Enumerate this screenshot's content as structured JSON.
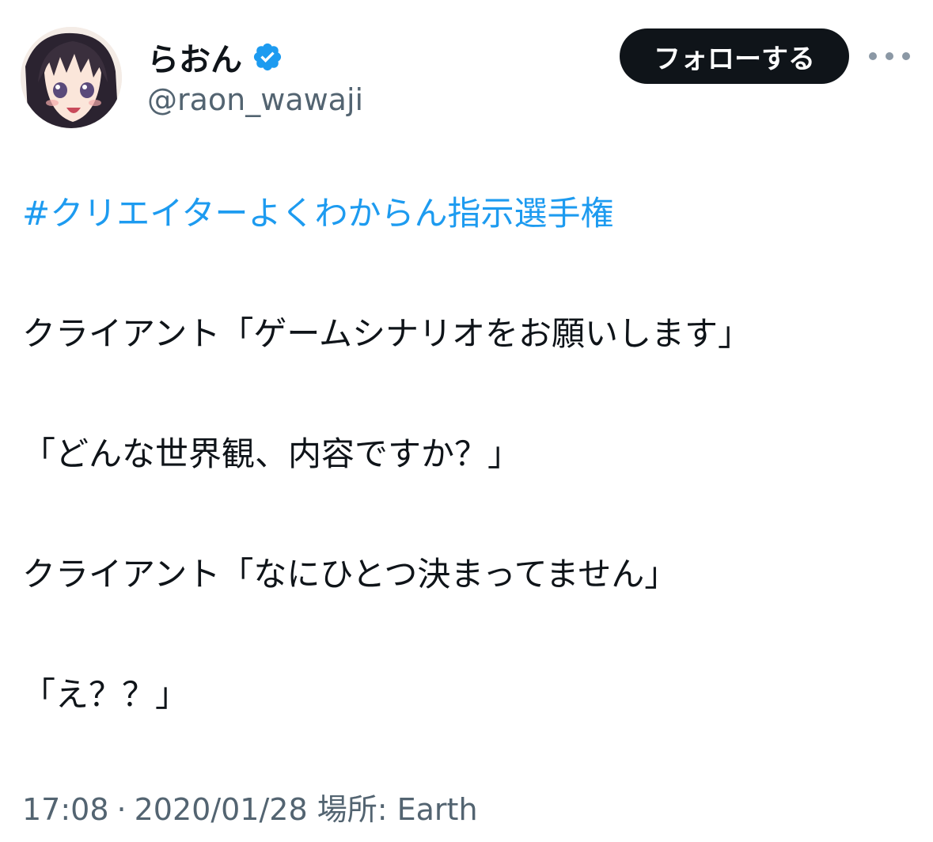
{
  "author": {
    "display_name": "らおん",
    "handle": "@raon_wawaji",
    "verified": true,
    "avatar_icon": "anime-girl-avatar-icon"
  },
  "actions": {
    "follow_label": "フォローする",
    "more_icon": "more-dots-icon"
  },
  "tweet": {
    "hashtag": "#クリエイターよくわからん指示選手権",
    "lines": [
      "クライアント「ゲームシナリオをお願いします」",
      "「どんな世界観、内容ですか？」",
      "クライアント「なにひとつ決まってません」",
      "「え？？」"
    ]
  },
  "meta": {
    "time": "17:08",
    "separator": "·",
    "date": "2020/01/28",
    "location_label": "場所:",
    "location": "Earth"
  },
  "colors": {
    "hashtag": "#1d9bf0",
    "verified_badge": "#1d9bf0",
    "follow_bg": "#0f1419",
    "muted_text": "#536471"
  }
}
